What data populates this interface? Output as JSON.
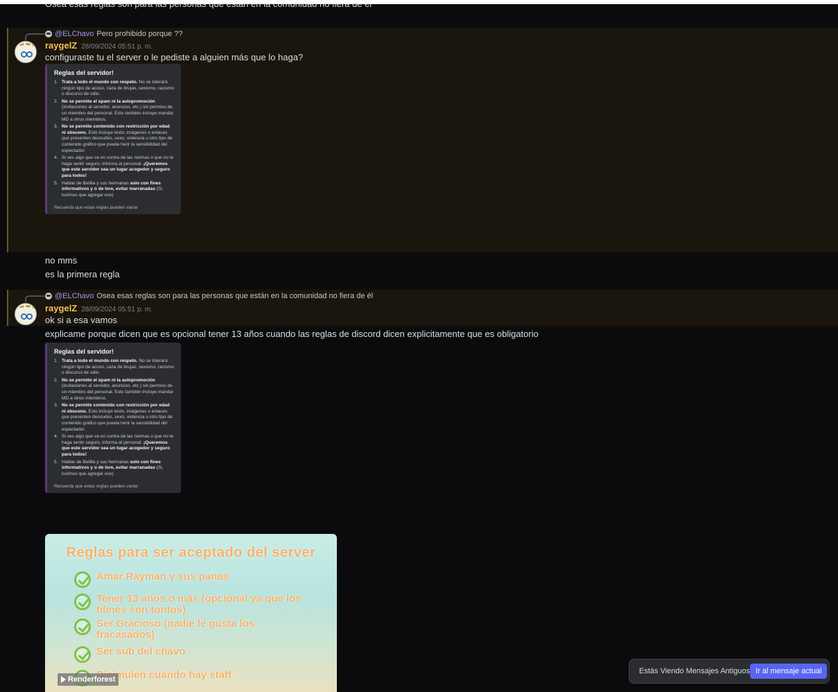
{
  "top_cut_text": "Osea esas reglas son para las personas que están en la comunidad no fiera de él",
  "messages": [
    {
      "reply": {
        "mention": "@ELChavo",
        "text": "Pero prohibido porque ??"
      },
      "author": "raygelZ",
      "timestamp": "28/09/2024 05:51 p. m.",
      "text": "configuraste tu el server o le pediste a alguien más que lo haga?"
    },
    {
      "lines": [
        "no mms",
        "es la primera regla"
      ]
    },
    {
      "reply": {
        "mention": "@ELChavo",
        "text": "Osea esas reglas son para las personas que están en la comunidad no fiera de él"
      },
      "author": "raygelZ",
      "timestamp": "28/09/2024 05:51 p. m.",
      "text": "ok si a esa vamos",
      "text2": "explicame porque dicen que es opcional tener 13 años cuando las reglas de discord dicen explicitamente que es obligatorio"
    }
  ],
  "embed": {
    "title": "Reglas del servidor!",
    "rules": [
      {
        "num": "1.",
        "bold": "Trata a todo el mundo con respeto.",
        "rest": " No se tolerará ningún tipo de acoso, caza de brujas, sexismo, racismo o discurso de odio."
      },
      {
        "num": "2.",
        "bold": "No se permite el spam ni la autopromoción",
        "rest": " (invitaciones al servidor, anuncios, etc.) sin permiso de un miembro del personal. Esto también incluye mandar MD a otros miembros."
      },
      {
        "num": "3.",
        "bold": "No se permite contenido con restricción por edad ni obsceno.",
        "rest": " Esto incluye texto, imágenes o enlaces que presenten desnudos, sexo, violencia u otro tipo de contenido gráfico que pueda herir la sensibilidad del espectador."
      },
      {
        "num": "4.",
        "pre": "Si ves algo que va en contra de las normas o que no te haga sentir seguro, informa al personal. ",
        "bold": "¡Queremos que este servidor sea un lugar acogedor y seguro para todos!"
      },
      {
        "num": "5.",
        "pre": "Hablar de Betilla y sus hermanas ",
        "bold": "solo con fines informativos y o de lore, evitar marranadas",
        "rest": " (Si, tuvimos que agregar eso)"
      }
    ],
    "footer": "Recuerda que estas reglas pueden variar"
  },
  "poster": {
    "title": "Reglas para ser aceptado del server",
    "items": [
      "Amar Rayman y sus panas",
      "Tener 13 años o más  (opcional ya que los tilines son tontos)",
      "Ser Gracioso (nadie le gusta los fracasados)",
      "Ser sub del chavo",
      "Disimulen cuando hay staff"
    ],
    "watermark": "Renderforest"
  },
  "jump": {
    "text": "Estás Viendo Mensajes Antiguos",
    "button": "Ir al mensaje actual"
  }
}
